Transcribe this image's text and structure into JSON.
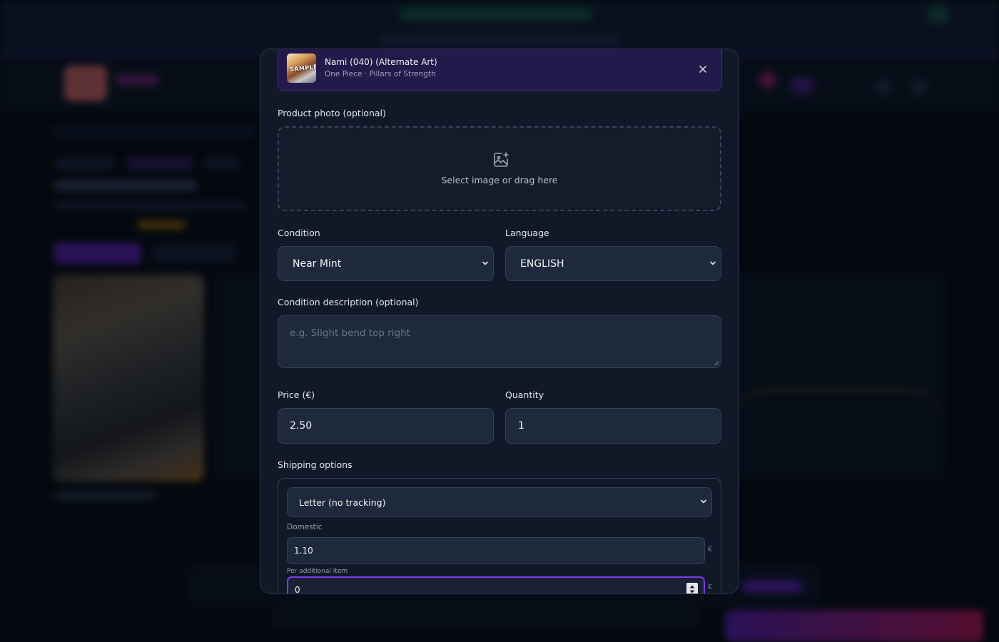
{
  "product": {
    "name": "Nami (040) (Alternate Art)",
    "subtitle": "One Piece · Pillars of Strength",
    "thumb_watermark": "SAMPLE"
  },
  "photo": {
    "label": "Product photo (optional)",
    "dropzone_text": "Select image or drag here"
  },
  "condition": {
    "label": "Condition",
    "value": "Near Mint"
  },
  "language": {
    "label": "Language",
    "value": "ENGLISH"
  },
  "condition_description": {
    "label": "Condition description (optional)",
    "placeholder": "e.g. Slight bend top right"
  },
  "price": {
    "label": "Price (€)",
    "value": "2.50"
  },
  "quantity": {
    "label": "Quantity",
    "value": "1"
  },
  "shipping": {
    "label": "Shipping options",
    "method": "Letter (no tracking)",
    "domestic_label": "Domestic",
    "domestic_value": "1.10",
    "additional_label": "Per additional item",
    "additional_value": "0",
    "currency": "€"
  },
  "colors": {
    "modal_bg": "#111827",
    "accent": "#7c3aed",
    "product_card_bg": "#23194a",
    "field_bg": "#1e293b"
  },
  "icons": {
    "close": "close-icon",
    "add_image": "image-add-icon",
    "chevron": "chevron-down-icon"
  }
}
